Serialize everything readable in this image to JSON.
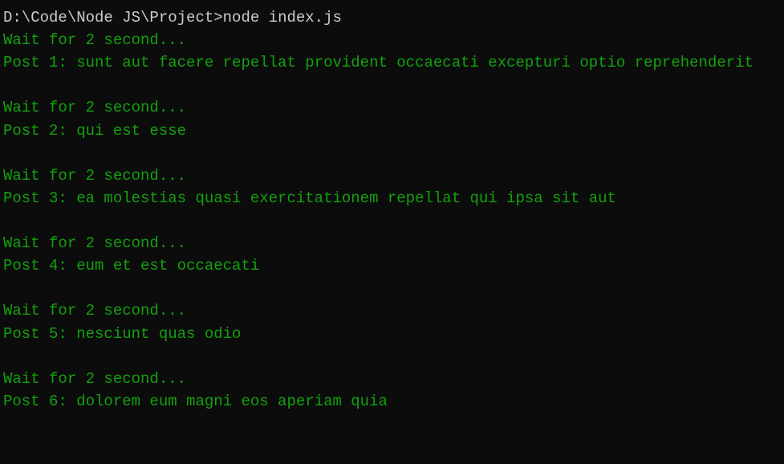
{
  "prompt": {
    "path": "D:\\Code\\Node JS\\Project>",
    "command": "node index.js"
  },
  "output": [
    "Wait for 2 second...",
    "Post 1: sunt aut facere repellat provident occaecati excepturi optio reprehenderit",
    "",
    "Wait for 2 second...",
    "Post 2: qui est esse",
    "",
    "Wait for 2 second...",
    "Post 3: ea molestias quasi exercitationem repellat qui ipsa sit aut",
    "",
    "Wait for 2 second...",
    "Post 4: eum et est occaecati",
    "",
    "Wait for 2 second...",
    "Post 5: nesciunt quas odio",
    "",
    "Wait for 2 second...",
    "Post 6: dolorem eum magni eos aperiam quia"
  ]
}
